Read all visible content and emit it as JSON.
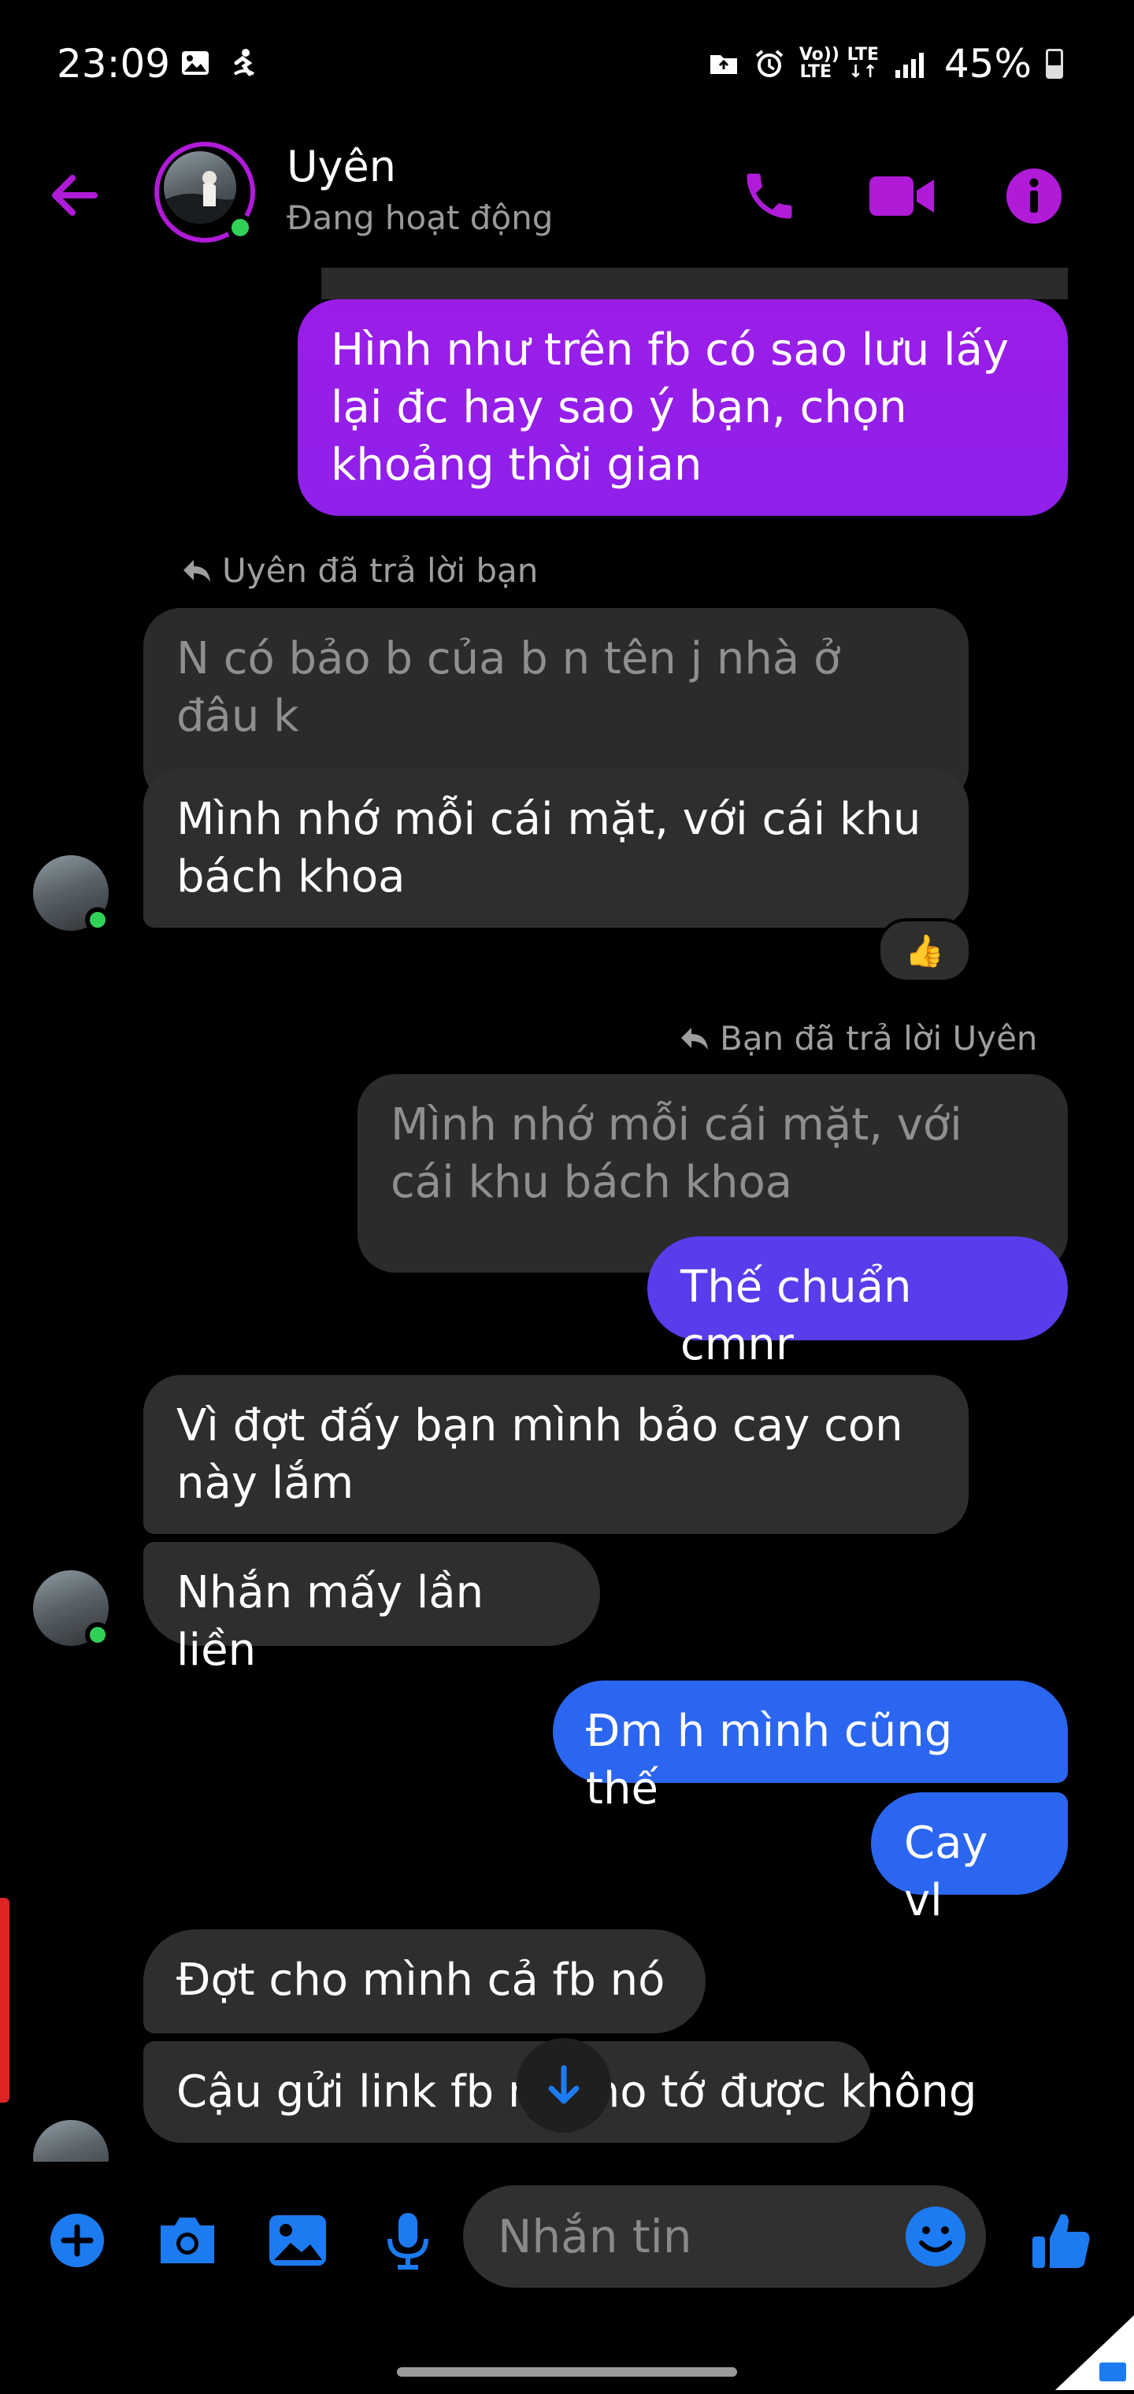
{
  "status_bar": {
    "time": "23:09",
    "volte": "Vo)) LTE",
    "lte": "LTE",
    "battery": "45%"
  },
  "header": {
    "contact_name": "Uyên",
    "contact_status": "Đang hoạt động"
  },
  "colors": {
    "accent_purple": "#b01bd8",
    "outgoing_purple": "#9b1ee8",
    "outgoing_indigo": "#5a3cec",
    "outgoing_blue": "#2b66f0",
    "incoming": "#2e2e2e",
    "online": "#31d158",
    "composer_blue": "#1d7bf2"
  },
  "messages": [
    {
      "id": "m1",
      "side": "out",
      "text": "Hình như trên fb có sao lưu lấy lại đc hay sao ý bạn, chọn khoảng thời gian"
    },
    {
      "id": "r1",
      "reply_note": "Uyên đã trả lời bạn"
    },
    {
      "id": "q1",
      "side": "quote",
      "text": "N có bảo b của b n tên j nhà ở đâu k"
    },
    {
      "id": "m2",
      "side": "in",
      "text": "Mình nhớ mỗi cái mặt, với cái khu bách khoa",
      "reaction": "👍"
    },
    {
      "id": "r2",
      "reply_note": "Bạn đã trả lời Uyên"
    },
    {
      "id": "q2",
      "side": "quote",
      "text": "Mình nhớ mỗi cái mặt, với cái khu bách khoa"
    },
    {
      "id": "m3",
      "side": "out",
      "text": "Thế chuẩn cmnr"
    },
    {
      "id": "m4",
      "side": "in",
      "text": "Vì đợt đấy bạn mình bảo cay con này lắm"
    },
    {
      "id": "m5",
      "side": "in",
      "text": "Nhắn mấy lần liền"
    },
    {
      "id": "m6",
      "side": "out",
      "text": "Đm h mình cũng thế"
    },
    {
      "id": "m7",
      "side": "out",
      "text": "Cay vl"
    },
    {
      "id": "m8",
      "side": "in",
      "text": "Đợt cho mình cả fb nó"
    },
    {
      "id": "m9",
      "side": "in",
      "text": "Cậu gửi link fb n    ho tớ được không"
    }
  ],
  "composer": {
    "placeholder": "Nhắn tin"
  }
}
